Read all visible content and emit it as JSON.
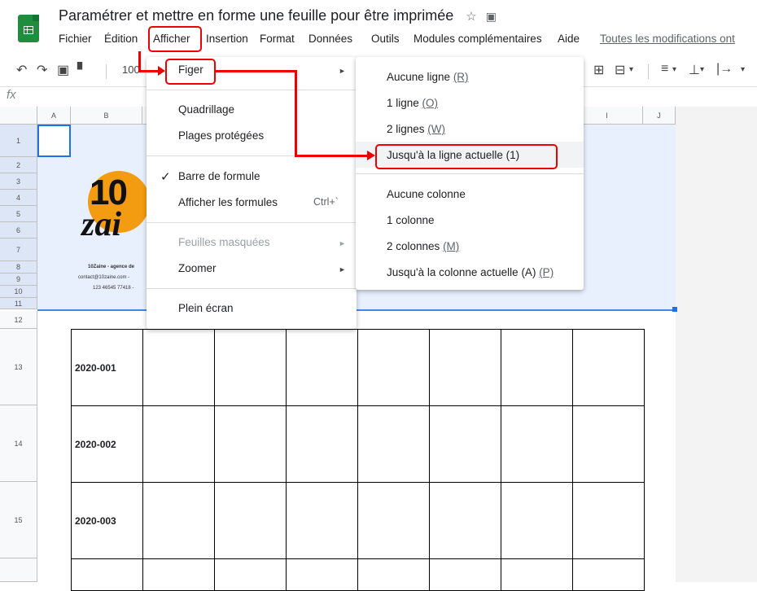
{
  "title": "Paramétrer et mettre en forme une feuille pour être imprimée",
  "menus": [
    "Fichier",
    "Édition",
    "Afficher",
    "Insertion",
    "Format",
    "Données",
    "Outils",
    "Modules complémentaires",
    "Aide"
  ],
  "save_status": "Toutes les modifications ont",
  "toolbar": {
    "zoom": "100"
  },
  "fx": "fx",
  "columns": [
    "A",
    "B",
    "I",
    "J"
  ],
  "rows": [
    "1",
    "2",
    "3",
    "4",
    "5",
    "6",
    "7",
    "8",
    "9",
    "10",
    "11",
    "12",
    "13",
    "14",
    "15"
  ],
  "brand": {
    "big1": "10",
    "big2": "zai",
    "line1": "10Zaine - agence de",
    "line2": "contact@10zaine.com -",
    "line3": "123 46545 77418 -"
  },
  "table_rows": [
    "2020-001",
    "2020-002",
    "2020-003"
  ],
  "afficher_menu": {
    "items": [
      {
        "label": "Figer",
        "arrow": true
      },
      {
        "label": "Quadrillage"
      },
      {
        "label": "Plages protégées"
      },
      {
        "label": "Barre de formule",
        "checked": true
      },
      {
        "label": "Afficher les formules",
        "shortcut": "Ctrl+`"
      },
      {
        "label": "Feuilles masquées",
        "disabled": true,
        "arrow": true
      },
      {
        "label": "Zoomer",
        "arrow": true
      },
      {
        "label": "Plein écran"
      }
    ]
  },
  "figer_menu": {
    "items": [
      {
        "pre": "Aucune ligne ",
        "key": "(R)"
      },
      {
        "pre": "1 ligne ",
        "key": "(O)"
      },
      {
        "pre": "2 lignes ",
        "key": "(W)"
      },
      {
        "pre": "Jusqu'à la ligne actuelle (1)",
        "key": ""
      },
      {
        "pre": "Aucune colonne",
        "key": ""
      },
      {
        "pre": "1 colonne",
        "key": ""
      },
      {
        "pre": "2 colonnes ",
        "key": "(M)"
      },
      {
        "pre": "Jusqu'à la colonne actuelle (A) ",
        "key": "(P)"
      }
    ]
  },
  "colors": {
    "accent": "#1a73e8",
    "annotation": "#e00000",
    "sheets_green": "#1e8e3e"
  }
}
